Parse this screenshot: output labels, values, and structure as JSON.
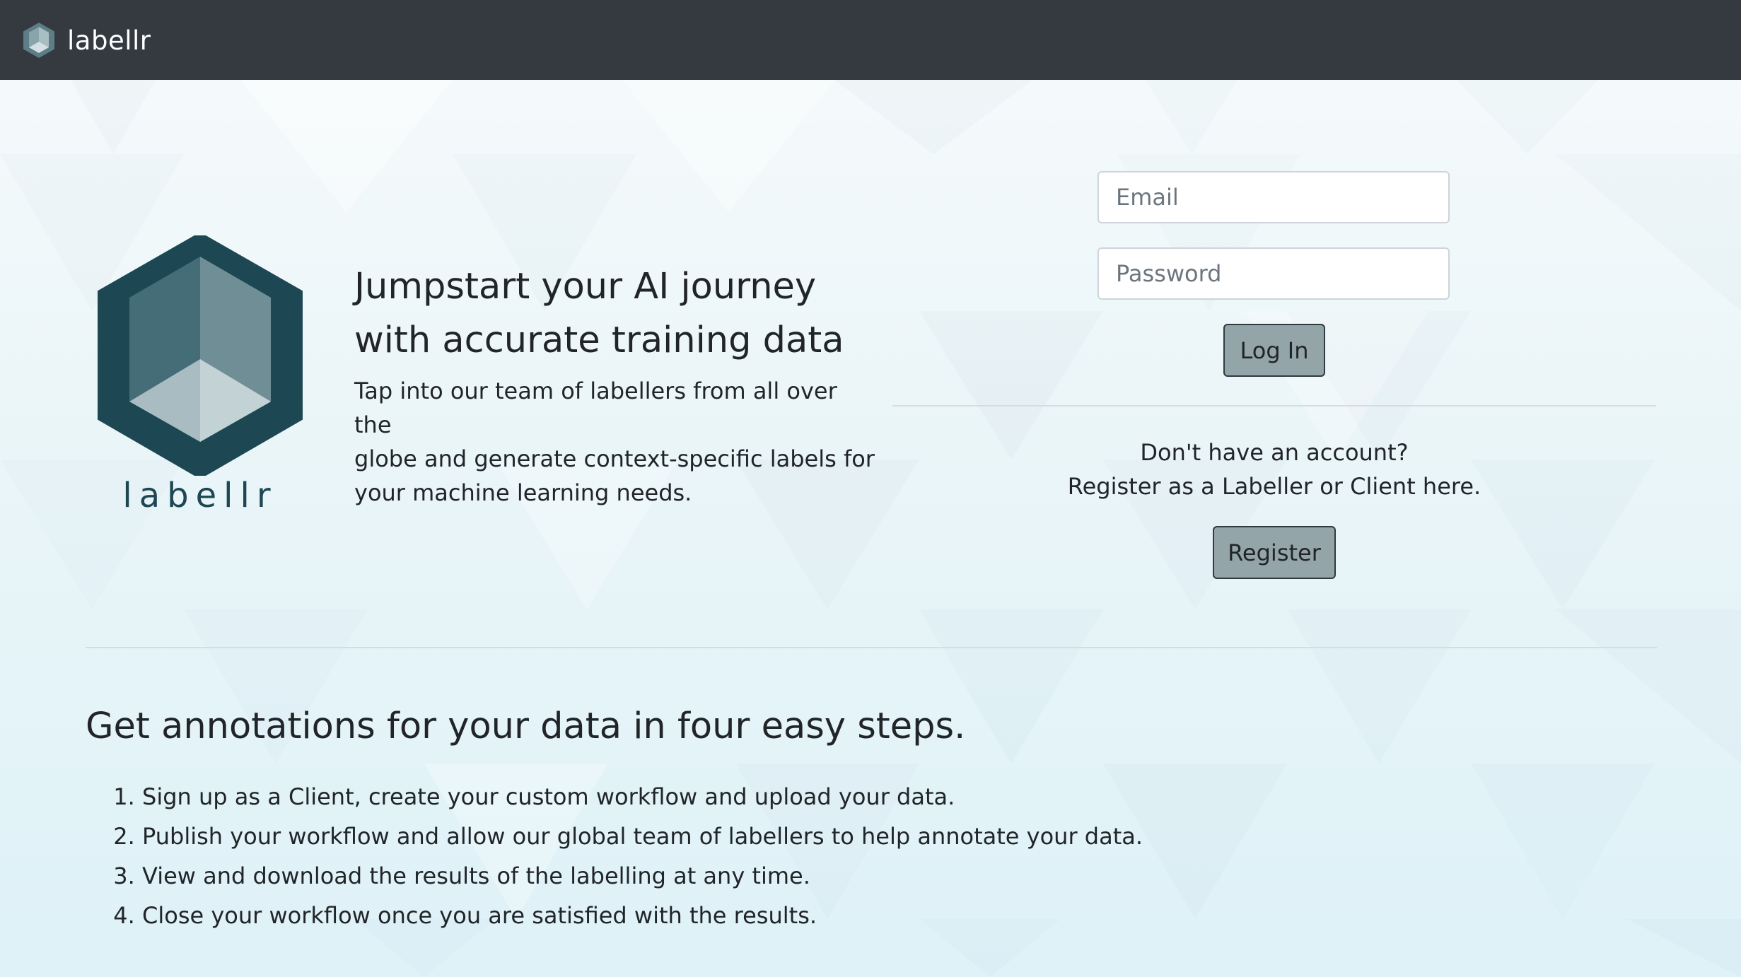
{
  "navbar": {
    "brand": "labellr",
    "logo_icon": "labellr-cube-icon"
  },
  "hero": {
    "logo_icon": "labellr-hexagon-logo",
    "logo_text": "labellr",
    "heading_line1": "Jumpstart your AI journey",
    "heading_line2": "with accurate training data",
    "desc_line1": "Tap into our team of labellers from all over the",
    "desc_line2": "globe and generate context-specific labels for",
    "desc_line3": "your machine learning needs."
  },
  "login": {
    "email_placeholder": "Email",
    "password_placeholder": "Password",
    "login_label": "Log In",
    "prompt_line1": "Don't have an account?",
    "prompt_line2": "Register as a Labeller or Client here.",
    "register_label": "Register"
  },
  "steps": {
    "heading": "Get annotations for your data in four easy steps.",
    "items": [
      "Sign up as a Client, create your custom workflow and upload your data.",
      "Publish your workflow and allow our global team of labellers to help annotate your data.",
      "View and download the results of the labelling at any time.",
      "Close your workflow once you are satisfied with the results."
    ]
  },
  "colors": {
    "navbar_bg": "#343a40",
    "button_bg": "#94a5a9",
    "brand_dark": "#1c4753",
    "page_bg": "#eaf5f8"
  }
}
